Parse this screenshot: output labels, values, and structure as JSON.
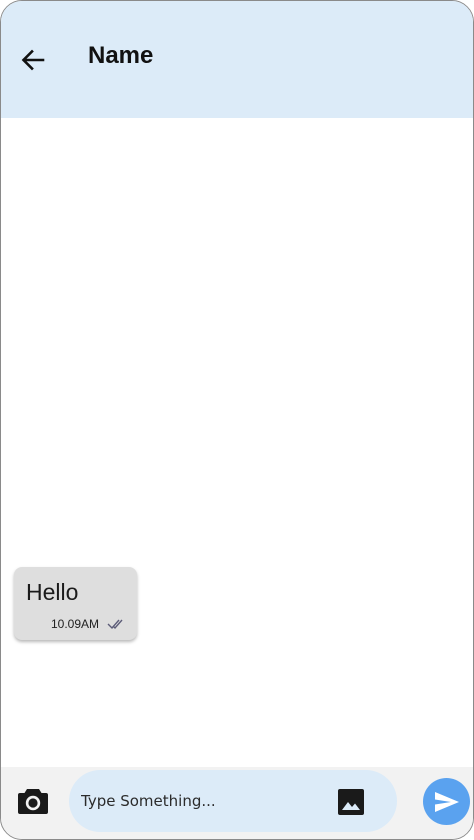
{
  "header": {
    "title": "Name",
    "back_icon": "arrow-left-icon"
  },
  "messages": [
    {
      "text": "Hello",
      "time": "10.09AM",
      "status_icon": "double-check-icon"
    }
  ],
  "composer": {
    "placeholder": "Type Something...",
    "camera_icon": "camera-icon",
    "gallery_icon": "image-icon",
    "send_icon": "send-icon"
  },
  "colors": {
    "app_bar": "#dcebf8",
    "input_pill": "#dcebf8",
    "bubble": "#dedede",
    "send_button": "#5aa2ef",
    "composer_bg": "#f2f2f2"
  }
}
